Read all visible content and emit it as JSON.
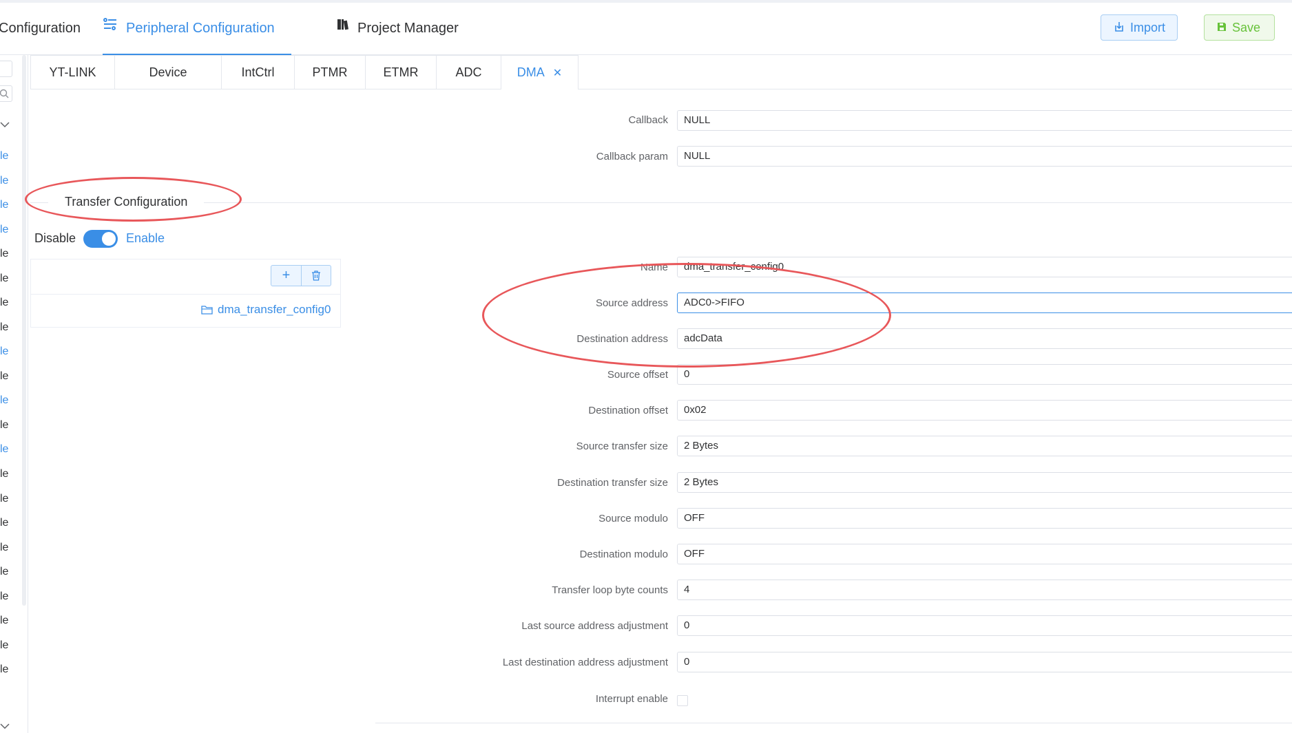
{
  "nav": {
    "items": [
      {
        "label": "Configuration"
      },
      {
        "label": "Peripheral Configuration"
      },
      {
        "label": "Project Manager"
      }
    ],
    "import_label": "Import",
    "save_label": "Save"
  },
  "sidebar": {
    "items": [
      "le",
      "le",
      "le",
      "le",
      "le",
      "le",
      "le",
      "le",
      "le",
      "le",
      "le",
      "le",
      "le",
      "le",
      "le",
      "le",
      "le",
      "le",
      "le",
      "le",
      "le",
      "le"
    ]
  },
  "tabs": [
    "YT-LINK",
    "Device",
    "IntCtrl",
    "PTMR",
    "ETMR",
    "ADC",
    "DMA"
  ],
  "active_tab": "DMA",
  "callback_fields": [
    {
      "label": "Callback",
      "value": "NULL"
    },
    {
      "label": "Callback param",
      "value": "NULL"
    }
  ],
  "transfer_section": {
    "title": "Transfer Configuration",
    "switch_off_label": "Disable",
    "switch_on_label": "Enable",
    "add_label": "+",
    "items": [
      "dma_transfer_config0"
    ]
  },
  "fields": [
    {
      "label": "Name",
      "value": "dma_transfer_config0"
    },
    {
      "label": "Source address",
      "value": "ADC0->FIFO"
    },
    {
      "label": "Destination address",
      "value": "adcData"
    },
    {
      "label": "Source offset",
      "value": "0"
    },
    {
      "label": "Destination offset",
      "value": "0x02"
    },
    {
      "label": "Source transfer size",
      "value": "2 Bytes"
    },
    {
      "label": "Destination transfer size",
      "value": "2 Bytes"
    },
    {
      "label": "Source modulo",
      "value": "OFF"
    },
    {
      "label": "Destination modulo",
      "value": "OFF"
    },
    {
      "label": "Transfer loop byte counts",
      "value": "4"
    },
    {
      "label": "Last source address adjustment",
      "value": "0"
    },
    {
      "label": "Last destination address adjustment",
      "value": "0"
    },
    {
      "label": "Interrupt enable",
      "value": ""
    }
  ],
  "colors": {
    "primary": "#3a8ee6",
    "success": "#67c23a",
    "annotation": "#e8575a"
  }
}
